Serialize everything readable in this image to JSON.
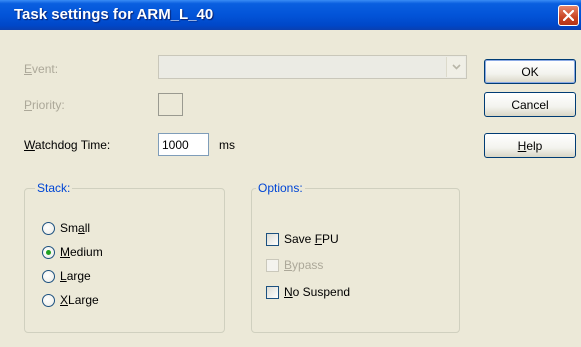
{
  "window": {
    "title": "Task settings for ARM_L_40",
    "close_icon": "close-x-icon"
  },
  "colors": {
    "titlebar": "#0254d8",
    "dialog_bg": "#ece9d8",
    "group_title": "#0046d5",
    "disabled_text": "#aca899",
    "close_button": "#c94423"
  },
  "form": {
    "event": {
      "label_key": "E",
      "label_rest": "vent:",
      "value": "",
      "disabled": true
    },
    "priority": {
      "label_key": "P",
      "label_rest": "riority:",
      "value": "",
      "disabled": true
    },
    "watchdog": {
      "label_key": "W",
      "label_rest": "atchdog Time:",
      "value": "1000",
      "unit": "ms"
    }
  },
  "buttons": {
    "ok": {
      "label": "OK"
    },
    "cancel": {
      "label": "Cancel"
    },
    "help": {
      "key": "H",
      "rest": "elp"
    }
  },
  "stack": {
    "title": "Stack:",
    "selected": "medium",
    "options": [
      {
        "id": "small",
        "pre": "Sm",
        "key": "a",
        "post": "ll"
      },
      {
        "id": "medium",
        "pre": "",
        "key": "M",
        "post": "edium"
      },
      {
        "id": "large",
        "pre": "",
        "key": "L",
        "post": "arge"
      },
      {
        "id": "xlarge",
        "pre": "",
        "key": "X",
        "post": "Large"
      }
    ]
  },
  "options": {
    "title": "Options:",
    "items": [
      {
        "id": "save-fpu",
        "pre": "Save ",
        "key": "F",
        "post": "PU",
        "checked": false,
        "disabled": false
      },
      {
        "id": "bypass",
        "pre": "",
        "key": "B",
        "post": "ypass",
        "checked": false,
        "disabled": true
      },
      {
        "id": "no-suspend",
        "pre": "",
        "key": "N",
        "post": "o Suspend",
        "checked": false,
        "disabled": false
      }
    ]
  }
}
